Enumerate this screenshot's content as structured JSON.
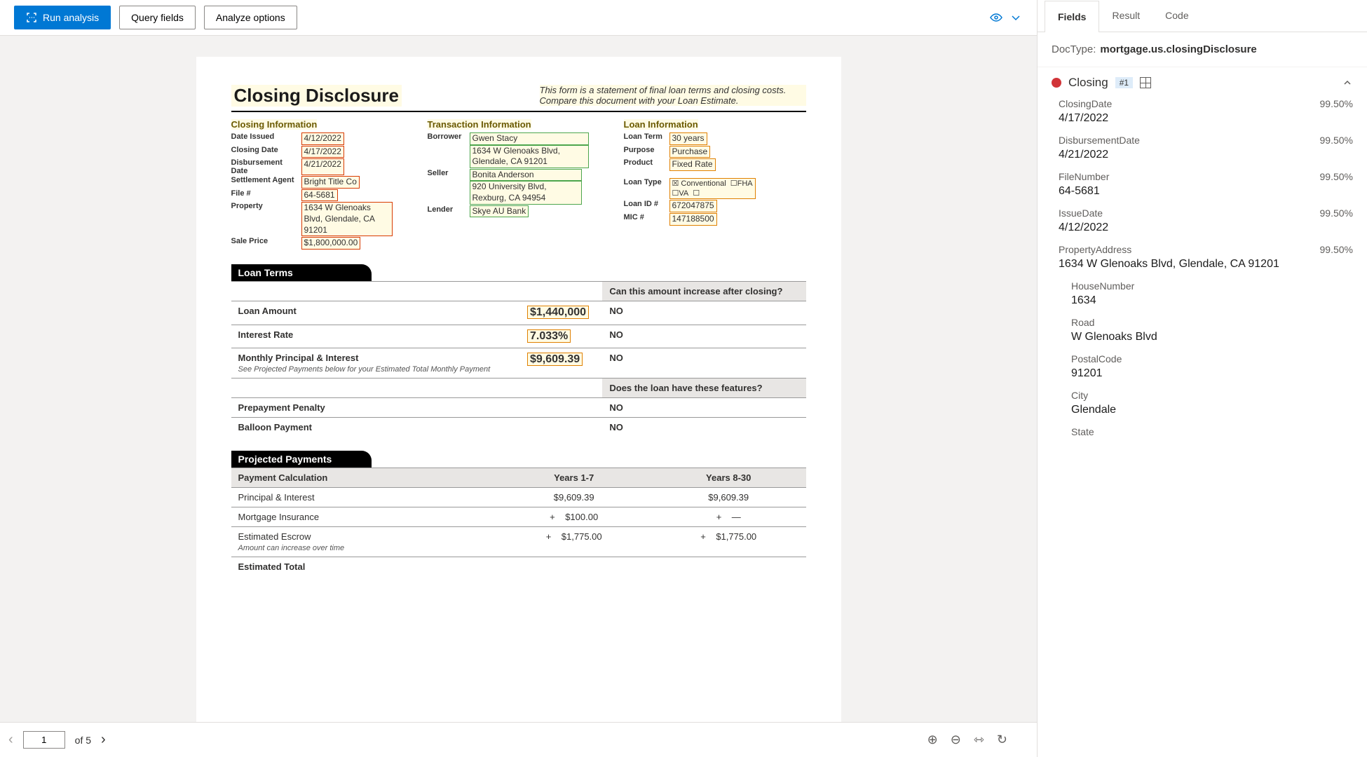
{
  "toolbar": {
    "run": "Run analysis",
    "query": "Query fields",
    "analyze": "Analyze options"
  },
  "doc": {
    "title": "Closing Disclosure",
    "subtitle": "This form is a statement of final loan terms and closing costs. Compare this document with your Loan Estimate.",
    "closing_info_hdr": "Closing  Information",
    "transaction_info_hdr": "Transaction  Information",
    "loan_info_hdr": "Loan  Information",
    "closing": {
      "date_issued_lbl": "Date Issued",
      "date_issued": "4/12/2022",
      "closing_date_lbl": "Closing Date",
      "closing_date": "4/17/2022",
      "disb_date_lbl": "Disbursement Date",
      "disb_date": "4/21/2022",
      "agent_lbl": "Settlement Agent",
      "agent": "Bright  Title Co",
      "file_lbl": "File #",
      "file": "64-5681",
      "property_lbl": "Property",
      "property": "1634 W Glenoaks Blvd, Glendale, CA 91201",
      "sale_lbl": "Sale Price",
      "sale": "$1,800,000.00"
    },
    "trans": {
      "borrower_lbl": "Borrower",
      "borrower_name": "Gwen Stacy",
      "borrower_addr": "1634 W Glenoaks Blvd, Glendale, CA 91201",
      "seller_lbl": "Seller",
      "seller_name": "Bonita Anderson",
      "seller_addr": "920 University Blvd, Rexburg, CA 94954",
      "lender_lbl": "Lender",
      "lender": "Skye AU Bank"
    },
    "loan": {
      "term_lbl": "Loan Term",
      "term": "30 years",
      "purpose_lbl": "Purpose",
      "purpose": "Purchase",
      "product_lbl": "Product",
      "product": "Fixed Rate",
      "type_lbl": "Loan Type",
      "type_conv": "Conventional",
      "type_fha": "FHA",
      "type_va": "VA",
      "id_lbl": "Loan ID #",
      "id": "672047875",
      "mic_lbl": "MIC #",
      "mic": "147188500"
    },
    "terms": {
      "hdr": "Loan Terms",
      "q": "Can this amount increase after closing?",
      "amount_lbl": "Loan Amount",
      "amount": "$1,440,000",
      "amount_a": "NO",
      "rate_lbl": "Interest Rate",
      "rate": "7.033%",
      "rate_a": "NO",
      "pi_lbl": "Monthly Principal & Interest",
      "pi_note": "See Projected Payments below for your Estimated Total Monthly Payment",
      "pi": "$9,609.39",
      "pi_a": "NO",
      "q2": "Does the loan have these features?",
      "prepay_lbl": "Prepayment Penalty",
      "prepay_a": "NO",
      "balloon_lbl": "Balloon Payment",
      "balloon_a": "NO"
    },
    "proj": {
      "hdr": "Projected Payments",
      "calc": "Payment Calculation",
      "y1": "Years 1-7",
      "y2": "Years 8-30",
      "pi_lbl": "Principal & Interest",
      "pi1": "$9,609.39",
      "pi2": "$9,609.39",
      "mi_lbl": "Mortgage Insurance",
      "mi1": "$100.00",
      "mi2": "—",
      "esc_lbl": "Estimated Escrow",
      "esc_note": "Amount can increase over time",
      "esc1": "$1,775.00",
      "esc2": "$1,775.00",
      "tot_lbl": "Estimated Total",
      "plus": "+"
    }
  },
  "pager": {
    "cur": "1",
    "of": "of 5"
  },
  "tabs": {
    "fields": "Fields",
    "result": "Result",
    "code": "Code"
  },
  "doctype": {
    "lbl": "DocType:",
    "val": "mortgage.us.closingDisclosure"
  },
  "group": {
    "name": "Closing",
    "badge": "#1"
  },
  "fields": [
    {
      "name": "ClosingDate",
      "conf": "99.50%",
      "val": "4/17/2022"
    },
    {
      "name": "DisbursementDate",
      "conf": "99.50%",
      "val": "4/21/2022"
    },
    {
      "name": "FileNumber",
      "conf": "99.50%",
      "val": "64-5681"
    },
    {
      "name": "IssueDate",
      "conf": "99.50%",
      "val": "4/12/2022"
    },
    {
      "name": "PropertyAddress",
      "conf": "99.50%",
      "val": "1634 W Glenoaks Blvd, Glendale, CA 91201",
      "sub": [
        {
          "name": "HouseNumber",
          "val": "1634"
        },
        {
          "name": "Road",
          "val": "W Glenoaks Blvd"
        },
        {
          "name": "PostalCode",
          "val": "91201"
        },
        {
          "name": "City",
          "val": "Glendale"
        },
        {
          "name": "State",
          "val": ""
        }
      ]
    }
  ]
}
